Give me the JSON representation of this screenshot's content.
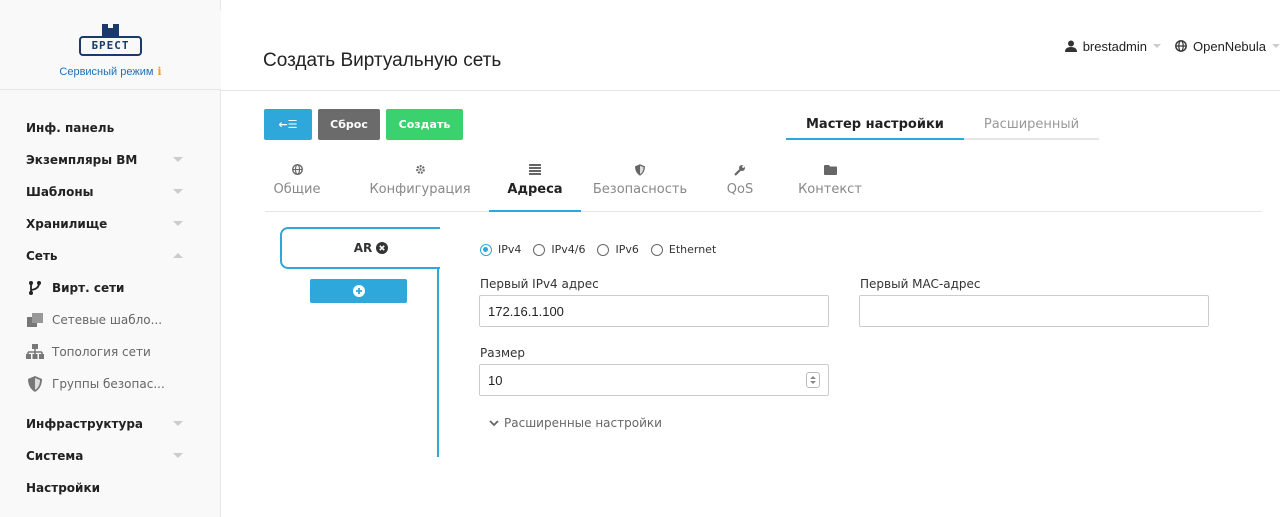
{
  "sidebar": {
    "logo_text": "БРЕСТ",
    "mode_label": "Сервисный режим",
    "mode_info": "ℹ",
    "items": [
      {
        "label": "Инф. панель"
      },
      {
        "label": "Экземпляры ВМ"
      },
      {
        "label": "Шаблоны"
      },
      {
        "label": "Хранилище"
      },
      {
        "label": "Сеть"
      },
      {
        "label": "Вирт. сети"
      },
      {
        "label": "Сетевые шабло..."
      },
      {
        "label": "Топология сети"
      },
      {
        "label": "Группы безопас..."
      },
      {
        "label": "Инфраструктура"
      },
      {
        "label": "Система"
      },
      {
        "label": "Настройки"
      }
    ]
  },
  "header": {
    "title": "Создать Виртуальную сеть",
    "user": "brestadmin",
    "zone": "OpenNebula"
  },
  "toolbar": {
    "back_label": "←☰",
    "reset_label": "Сброс",
    "create_label": "Создать"
  },
  "mode_tabs": [
    {
      "label": "Мастер настройки",
      "active": true
    },
    {
      "label": "Расширенный",
      "active": false
    }
  ],
  "section_tabs": [
    {
      "label": "Общие",
      "icon": "globe-icon"
    },
    {
      "label": "Конфигурация",
      "icon": "gear-icon"
    },
    {
      "label": "Адреса",
      "icon": "list-icon"
    },
    {
      "label": "Безопасность",
      "icon": "shield-icon"
    },
    {
      "label": "QoS",
      "icon": "wrench-icon"
    },
    {
      "label": "Контекст",
      "icon": "folder-icon"
    }
  ],
  "ar": {
    "tab_label": "AR"
  },
  "form": {
    "radios": [
      "IPv4",
      "IPv4/6",
      "IPv6",
      "Ethernet"
    ],
    "ipv4_label": "Первый IPv4 адрес",
    "ipv4_value": "172.16.1.100",
    "mac_label": "Первый MAC-адрес",
    "mac_value": "",
    "size_label": "Размер",
    "size_value": "10",
    "advanced_label": "Расширенные настройки"
  },
  "colors": {
    "accent": "#2ea8db",
    "create": "#3bd16f",
    "reset": "#6b6b6b"
  }
}
